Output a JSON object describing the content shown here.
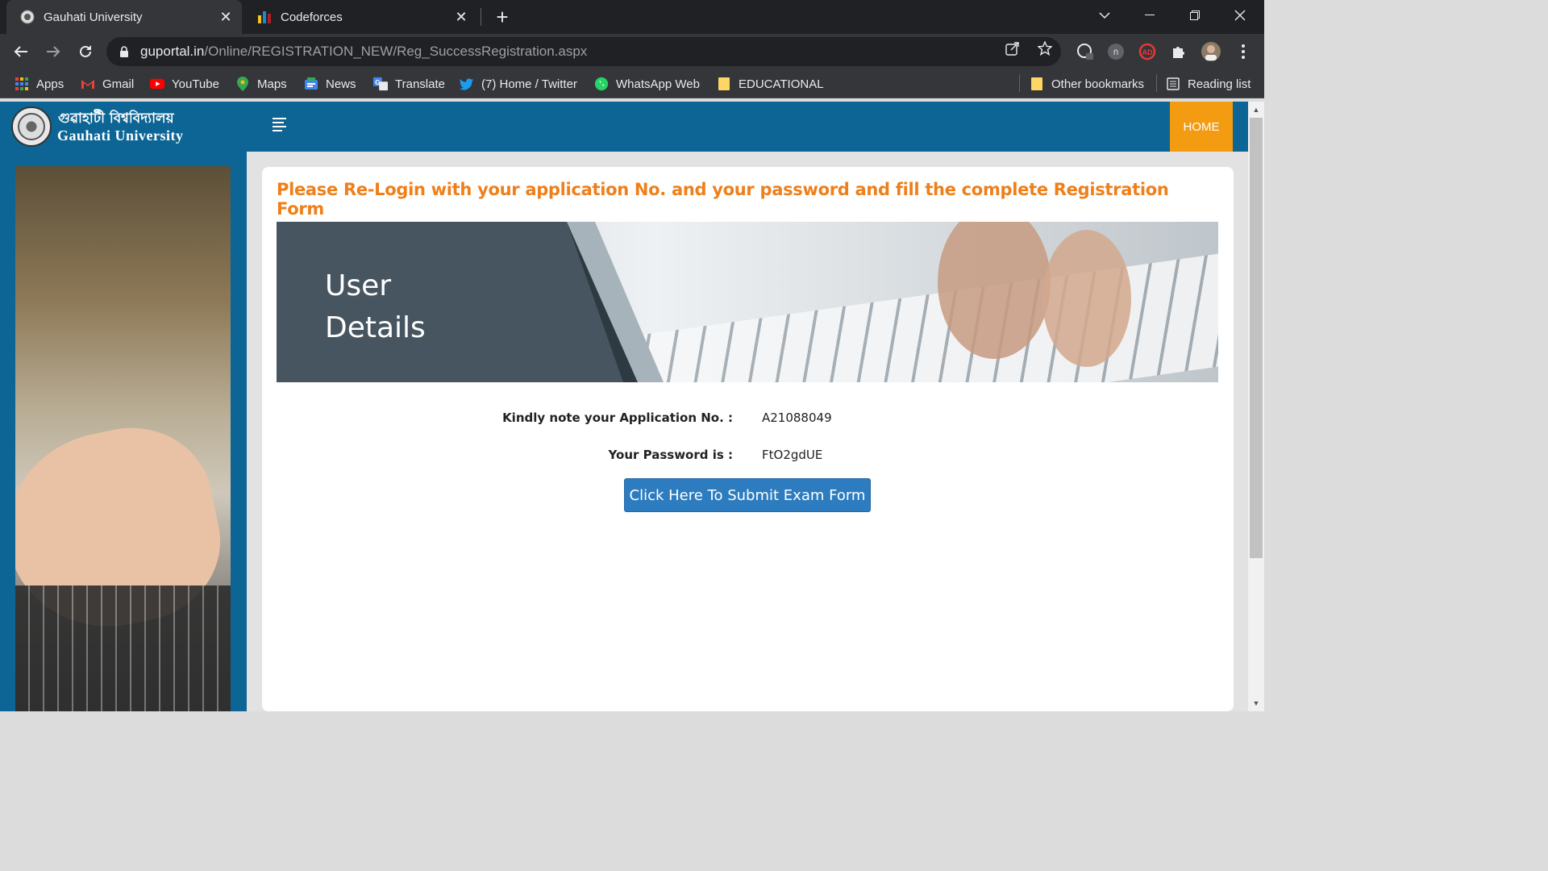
{
  "browser": {
    "tabs": [
      {
        "title": "Gauhati University",
        "active": true,
        "icon": "university-seal-icon"
      },
      {
        "title": "Codeforces",
        "active": false,
        "icon": "codeforces-bars-icon"
      }
    ],
    "url_host": "guportal.in",
    "url_path": "/Online/REGISTRATION_NEW/Reg_SuccessRegistration.aspx"
  },
  "bookmarks": {
    "items": [
      {
        "label": "Apps",
        "icon": "apps-grid-icon"
      },
      {
        "label": "Gmail",
        "icon": "gmail-icon"
      },
      {
        "label": "YouTube",
        "icon": "youtube-icon"
      },
      {
        "label": "Maps",
        "icon": "maps-pin-icon"
      },
      {
        "label": "News",
        "icon": "news-icon"
      },
      {
        "label": "Translate",
        "icon": "translate-icon"
      },
      {
        "label": "(7) Home / Twitter",
        "icon": "twitter-bird-icon"
      },
      {
        "label": "WhatsApp Web",
        "icon": "whatsapp-icon"
      },
      {
        "label": "EDUCATIONAL",
        "icon": "folder-icon"
      }
    ],
    "other": "Other bookmarks",
    "reading_list": "Reading list"
  },
  "site": {
    "brand_bn": "গুৱাহাটী বিশ্ববিদ্যালয়",
    "brand_en": "Gauhati University",
    "home_label": "HOME"
  },
  "main": {
    "notice": "Please Re-Login with your application No. and your password and fill the complete Registration Form",
    "banner_title": "User Details",
    "application_label": "Kindly note your Application No. :",
    "application_value": "A21088049",
    "password_label": "Your Password is :",
    "password_value": "FtO2gdUE",
    "submit_label": "Click Here To Submit Exam Form"
  },
  "colors": {
    "header_blue": "#0c6595",
    "home_orange": "#f39c12",
    "notice_orange": "#ef7f1a",
    "button_blue": "#2d7cbf"
  }
}
